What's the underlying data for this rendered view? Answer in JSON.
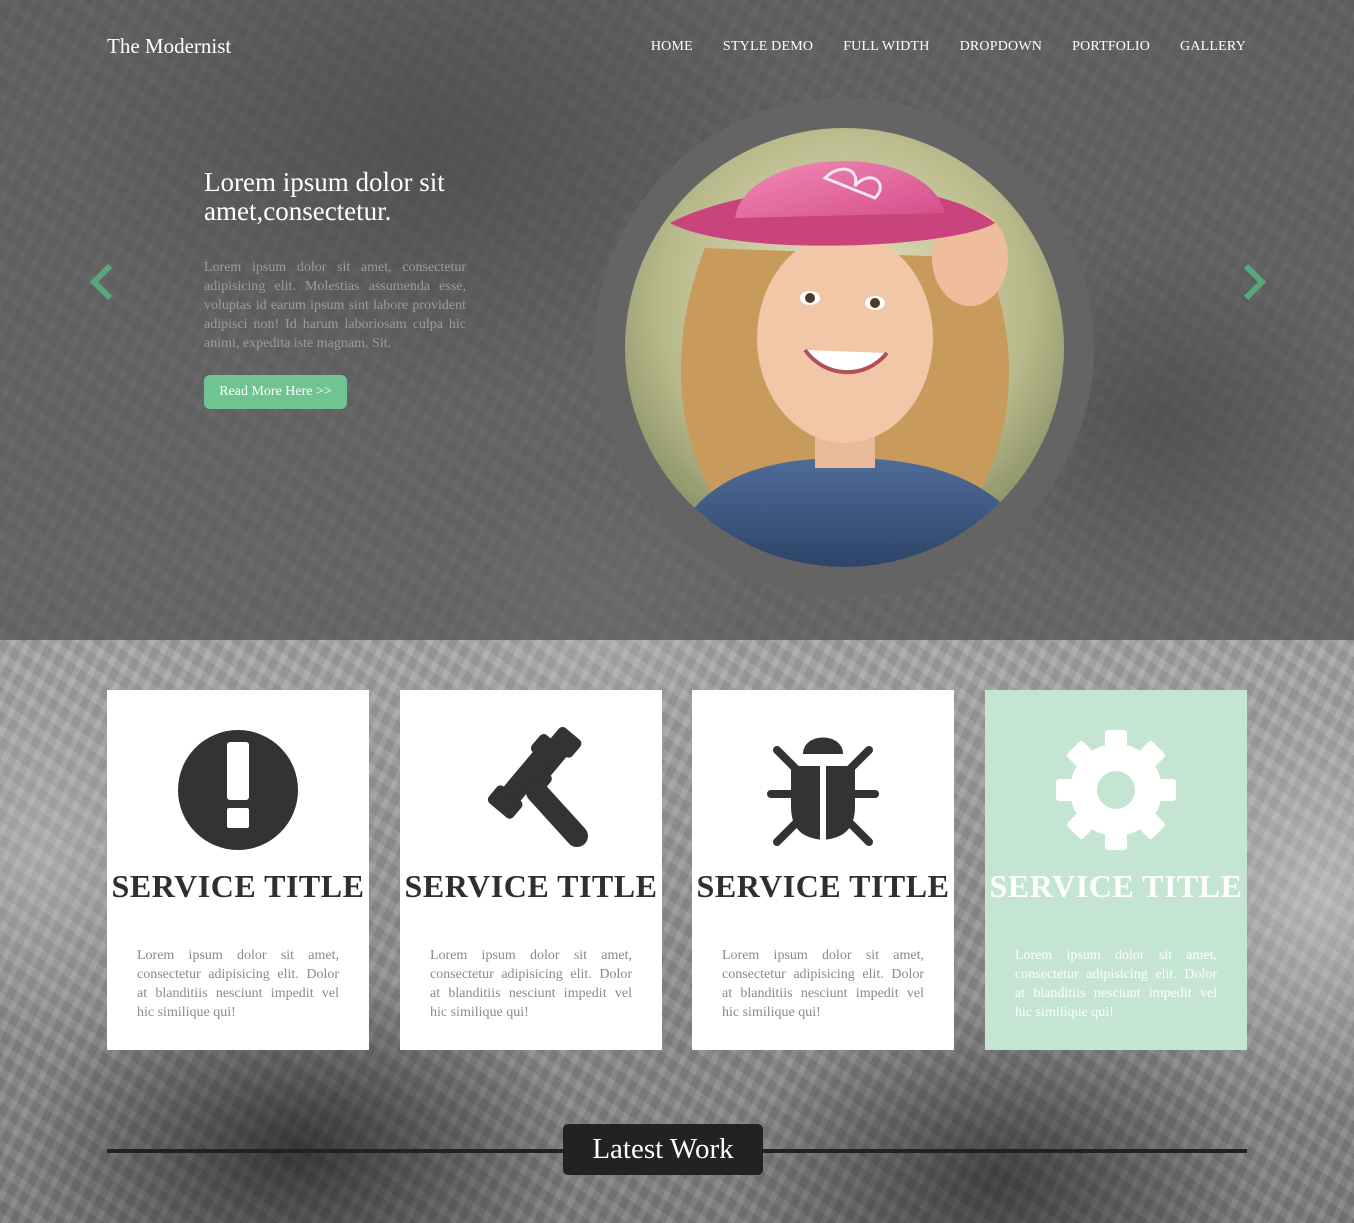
{
  "site": {
    "brand": "The Modernist"
  },
  "nav": {
    "items": [
      {
        "label": "HOME"
      },
      {
        "label": "STYLE DEMO"
      },
      {
        "label": "FULL WIDTH"
      },
      {
        "label": "DROPDOWN"
      },
      {
        "label": "PORTFOLIO"
      },
      {
        "label": "GALLERY"
      }
    ]
  },
  "hero": {
    "title": "Lorem ipsum dolor sit amet,consectetur.",
    "text": "Lorem ipsum dolor sit amet, consectetur adipisicing elit. Molestias assumenda esse, voluptas id earum ipsum sint labore provident adipisci non! Id harum laboriosam culpa hic animi, expedita iste magnam. Sit.",
    "button_label": "Read More Here >>",
    "prev_icon": "chevron-left-icon",
    "next_icon": "chevron-right-icon",
    "accent_color": "#70c492"
  },
  "services": [
    {
      "icon": "exclamation-icon",
      "title": "SERVICE TITLE",
      "text": "Lorem ipsum dolor sit amet, consectetur adipisicing elit. Dolor at blanditiis nesciunt impedit vel hic similique qui!"
    },
    {
      "icon": "gavel-icon",
      "title": "SERVICE TITLE",
      "text": "Lorem ipsum dolor sit amet, consectetur adipisicing elit. Dolor at blanditiis nesciunt impedit vel hic similique qui!"
    },
    {
      "icon": "bug-icon",
      "title": "SERVICE TITLE",
      "text": "Lorem ipsum dolor sit amet, consectetur adipisicing elit. Dolor at blanditiis nesciunt impedit vel hic similique qui!"
    },
    {
      "icon": "gear-icon",
      "title": "SERVICE TITLE",
      "text": "Lorem ipsum dolor sit amet, consectetur adipisicing elit. Dolor at blanditiis nesciunt impedit vel hic similique qui!"
    }
  ],
  "latest_work": {
    "label": "Latest Work"
  }
}
